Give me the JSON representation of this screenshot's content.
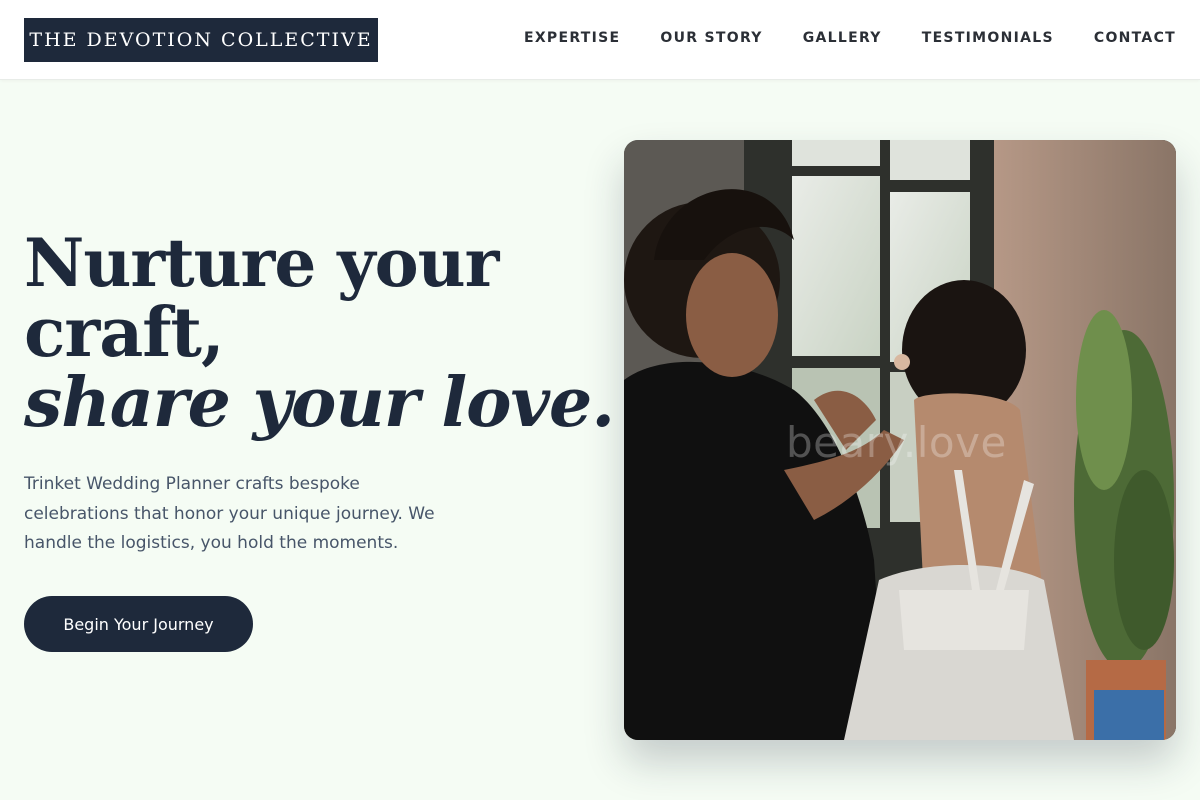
{
  "brand": {
    "name": "THE DEVOTION COLLECTIVE"
  },
  "nav": {
    "items": [
      {
        "label": "EXPERTISE"
      },
      {
        "label": "OUR STORY"
      },
      {
        "label": "GALLERY"
      },
      {
        "label": "TESTIMONIALS"
      },
      {
        "label": "CONTACT"
      }
    ]
  },
  "hero": {
    "headline_line1": "Nurture your",
    "headline_line2": "craft,",
    "headline_line3": "share your love.",
    "description": "Trinket Wedding Planner crafts bespoke celebrations that honor your unique journey. We handle the logistics, you hold the moments.",
    "cta_label": "Begin Your Journey",
    "image_watermark": "beary.love"
  },
  "colors": {
    "page_background": "#f5fcf4",
    "primary_navy": "#1e293b",
    "body_text": "#475569",
    "header_background": "#ffffff"
  }
}
